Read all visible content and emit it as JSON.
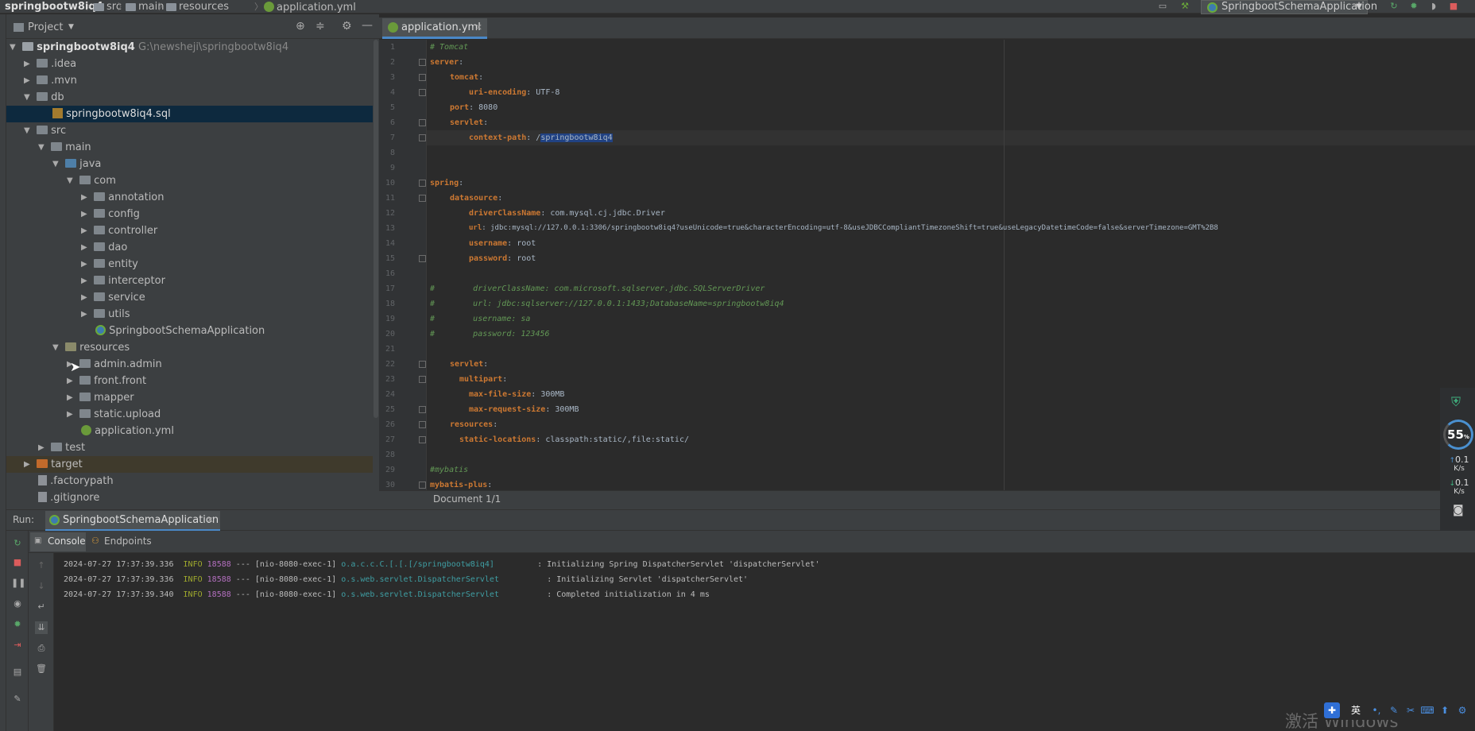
{
  "breadcrumb": {
    "project": "springbootw8iq4",
    "items": [
      "src",
      "main",
      "resources",
      "application.yml"
    ]
  },
  "toolbar": {
    "run_config": "SpringbootSchemaApplication"
  },
  "project_panel": {
    "title": "Project",
    "root_name": "springbootw8iq4",
    "root_path": "G:\\newsheji\\springbootw8iq4",
    "items": [
      ".idea",
      ".mvn",
      "db",
      "springbootw8iq4.sql",
      "src",
      "main",
      "java",
      "com",
      "annotation",
      "config",
      "controller",
      "dao",
      "entity",
      "interceptor",
      "service",
      "utils",
      "SpringbootSchemaApplication",
      "resources",
      "admin.admin",
      "front.front",
      "mapper",
      "static.upload",
      "application.yml",
      "test",
      "target",
      ".factorypath",
      ".gitignore"
    ]
  },
  "editor": {
    "tab": "application.yml",
    "status": "Document 1/1",
    "line_numbers": [
      "1",
      "2",
      "3",
      "4",
      "5",
      "6",
      "7",
      "8",
      "9",
      "10",
      "11",
      "12",
      "13",
      "14",
      "15",
      "16",
      "17",
      "18",
      "19",
      "20",
      "21",
      "22",
      "23",
      "24",
      "25",
      "26",
      "27",
      "28",
      "29",
      "30"
    ],
    "code": {
      "l1": "# Tomcat",
      "l2k": "server",
      "l2v": ":",
      "l3k": "tomcat",
      "l3v": ":",
      "l4k": "uri-encoding",
      "l4v": ": UTF-8",
      "l5k": "port",
      "l5v": ": 8080",
      "l6k": "servlet",
      "l6v": ":",
      "l7k": "context-path",
      "l7v": ": /",
      "l7h": "springbootw8iq4",
      "l10k": "spring",
      "l10v": ":",
      "l11k": "datasource",
      "l11v": ":",
      "l12k": "driverClassName",
      "l12v": ": com.mysql.cj.jdbc.Driver",
      "l13k": "url",
      "l13v": ": jdbc:mysql://127.0.0.1:3306/springbootw8iq4?useUnicode=true&characterEncoding=utf-8&useJDBCCompliantTimezoneShift=true&useLegacyDatetimeCode=false&serverTimezone=GMT%2B8",
      "l14k": "username",
      "l14v": ": root",
      "l15k": "password",
      "l15v": ": root",
      "l17": "#        driverClassName: com.microsoft.sqlserver.jdbc.SQLServerDriver",
      "l18": "#        url: jdbc:sqlserver://127.0.0.1:1433;DatabaseName=springbootw8iq4",
      "l19": "#        username: sa",
      "l20": "#        password: 123456",
      "l22k": "servlet",
      "l22v": ":",
      "l23k": "multipart",
      "l23v": ":",
      "l24k": "max-file-size",
      "l24v": ": 300MB",
      "l25k": "max-request-size",
      "l25v": ": 300MB",
      "l26k": "resources",
      "l26v": ":",
      "l27k": "static-locations",
      "l27v": ": classpath:static/,file:static/",
      "l29": "#mybatis",
      "l30k": "mybatis-plus",
      "l30v": ":"
    }
  },
  "run_panel": {
    "label": "Run:",
    "tab": "SpringbootSchemaApplication",
    "console_tab": "Console",
    "endpoints_tab": "Endpoints",
    "logs": [
      {
        "ts": "2024-07-27 17:37:39.336",
        "level": "INFO",
        "pid": "18588",
        "sep": "---",
        "thread": "[nio-8080-exec-1]",
        "cls": "o.a.c.c.C.[.[.[/springbootw8iq4]",
        "msg": ": Initializing Spring DispatcherServlet 'dispatcherServlet'"
      },
      {
        "ts": "2024-07-27 17:37:39.336",
        "level": "INFO",
        "pid": "18588",
        "sep": "---",
        "thread": "[nio-8080-exec-1]",
        "cls": "o.s.web.servlet.DispatcherServlet",
        "msg": ": Initializing Servlet 'dispatcherServlet'"
      },
      {
        "ts": "2024-07-27 17:37:39.340",
        "level": "INFO",
        "pid": "18588",
        "sep": "---",
        "thread": "[nio-8080-exec-1]",
        "cls": "o.s.web.servlet.DispatcherServlet",
        "msg": ": Completed initialization in 4 ms"
      }
    ]
  },
  "system_widget": {
    "gauge": "55",
    "gauge_unit": "%",
    "up_speed": "0.1",
    "up_unit": "K/s",
    "down_speed": "0.1",
    "down_unit": "K/s"
  },
  "ime": {
    "lang": "英"
  },
  "watermark": "激活 Windows",
  "colors": {
    "accent": "#4a88c7",
    "keyword": "#cc7832",
    "comment": "#629755",
    "background": "#2b2b2b"
  }
}
